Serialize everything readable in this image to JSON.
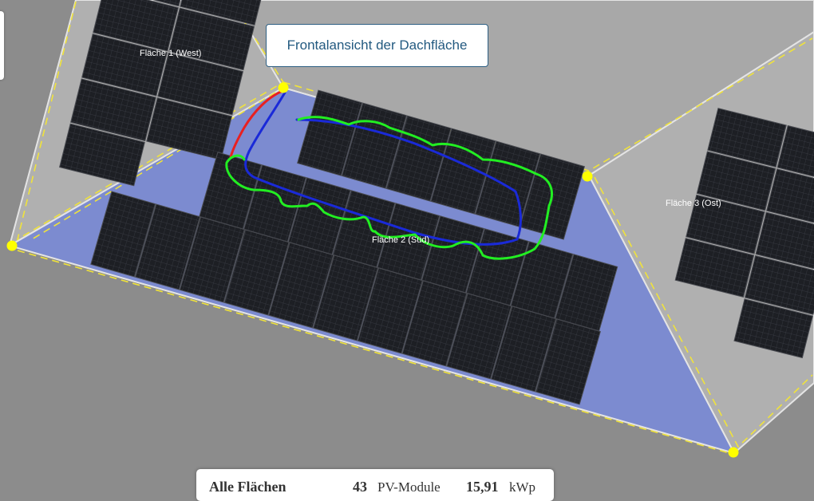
{
  "view_button": {
    "label": "Frontalansicht der Dachfläche"
  },
  "areas": [
    {
      "label": "Fläche 1 (West)"
    },
    {
      "label": "Fläche 2 (Süd)"
    },
    {
      "label": "Fläche 3 (Ost)"
    }
  ],
  "summary": {
    "label": "Alle Flächen",
    "module_count": "43",
    "module_unit": "PV-Module",
    "power": "15,91",
    "power_unit": "kWp"
  },
  "colors": {
    "background": "#8c8c8c",
    "roof_surface": "#b0b0b0",
    "active_area": "#7c8bd0",
    "panel": "#1d1f24",
    "corner_marker": "#ffff00",
    "boundary_dash": "#f0e33a",
    "annotation_green": "#22ee22",
    "annotation_blue": "#1a2ad8",
    "annotation_red": "#e82020"
  }
}
